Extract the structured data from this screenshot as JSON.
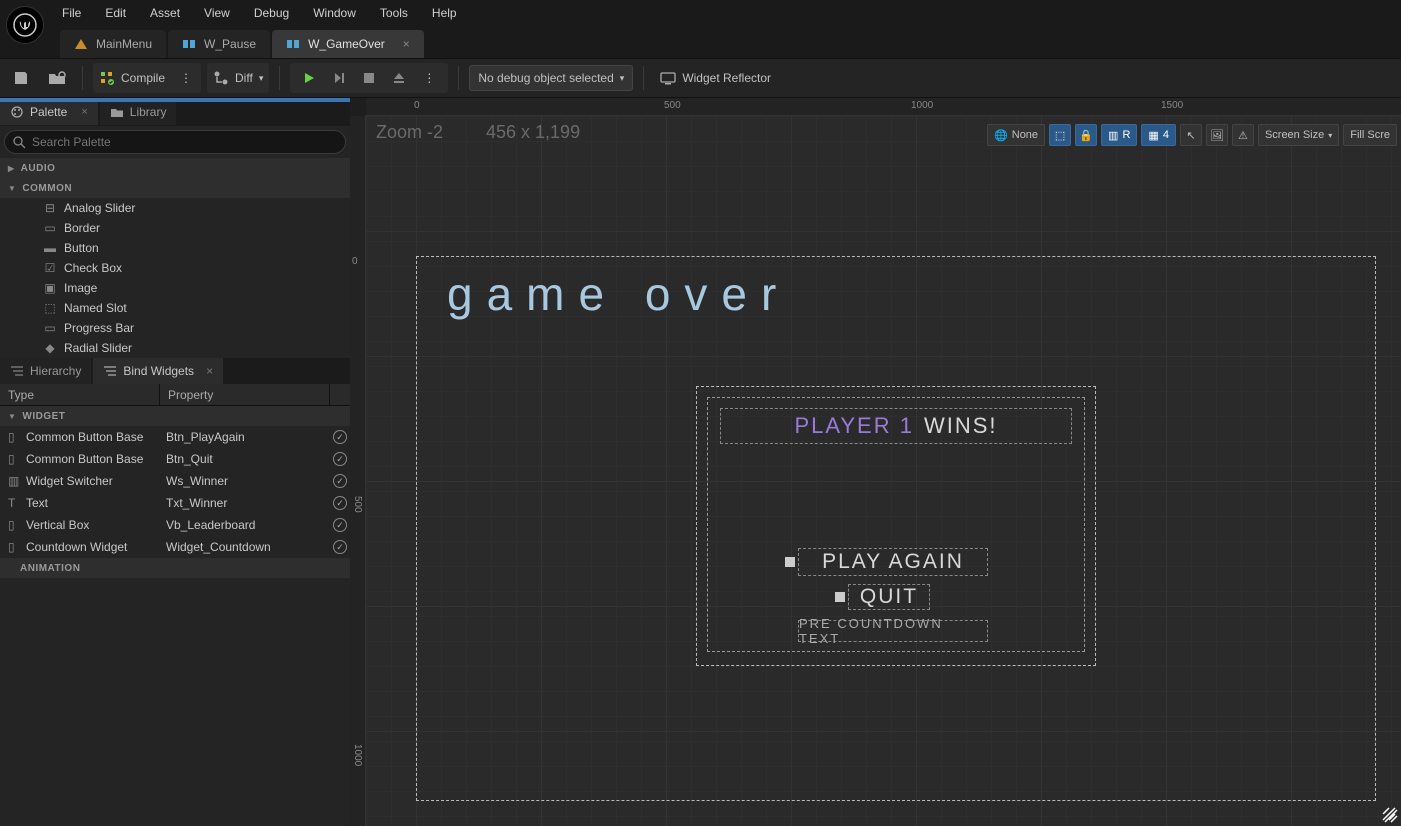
{
  "menu": {
    "items": [
      "File",
      "Edit",
      "Asset",
      "View",
      "Debug",
      "Window",
      "Tools",
      "Help"
    ]
  },
  "doc_tabs": [
    {
      "label": "MainMenu",
      "icon": "mainmenu",
      "active": false,
      "closeable": false
    },
    {
      "label": "W_Pause",
      "icon": "widget",
      "active": false,
      "closeable": false
    },
    {
      "label": "W_GameOver",
      "icon": "widget",
      "active": true,
      "closeable": true
    }
  ],
  "toolbar": {
    "compile": "Compile",
    "diff": "Diff",
    "debug_select": "No debug object selected",
    "widget_reflector": "Widget Reflector"
  },
  "palette": {
    "tab": "Palette",
    "library_tab": "Library",
    "search_placeholder": "Search Palette",
    "cat_audio": "AUDIO",
    "cat_common": "COMMON",
    "items": [
      "Analog Slider",
      "Border",
      "Button",
      "Check Box",
      "Image",
      "Named Slot",
      "Progress Bar",
      "Radial Slider"
    ]
  },
  "hierarchy": {
    "tab1": "Hierarchy",
    "tab2": "Bind Widgets",
    "hdr_type": "Type",
    "hdr_prop": "Property",
    "cat_widget": "WIDGET",
    "cat_animation": "ANIMATION",
    "rows": [
      {
        "type": "Common Button Base",
        "prop": "Btn_PlayAgain"
      },
      {
        "type": "Common Button Base",
        "prop": "Btn_Quit"
      },
      {
        "type": "Widget Switcher",
        "prop": "Ws_Winner"
      },
      {
        "type": "Text",
        "prop": "Txt_Winner"
      },
      {
        "type": "Vertical Box",
        "prop": "Vb_Leaderboard"
      },
      {
        "type": "Countdown Widget",
        "prop": "Widget_Countdown"
      }
    ]
  },
  "canvas": {
    "zoom": "Zoom -2",
    "dims": "456 x 1,199",
    "ruler_h": [
      "0",
      "500",
      "1000",
      "1500"
    ],
    "ruler_v": [
      "0",
      "500",
      "1000"
    ],
    "toolbar": {
      "none": "None",
      "r": "R",
      "grid_n": "4",
      "screen_size": "Screen Size",
      "fill": "Fill Scre"
    },
    "game_over_title": "Game Over",
    "winner_player": "PLAYER 1",
    "winner_wins": "WINS!",
    "play_again": "PLAY AGAIN",
    "quit": "QUIT",
    "countdown": "PRE COUNTDOWN TEXT"
  }
}
